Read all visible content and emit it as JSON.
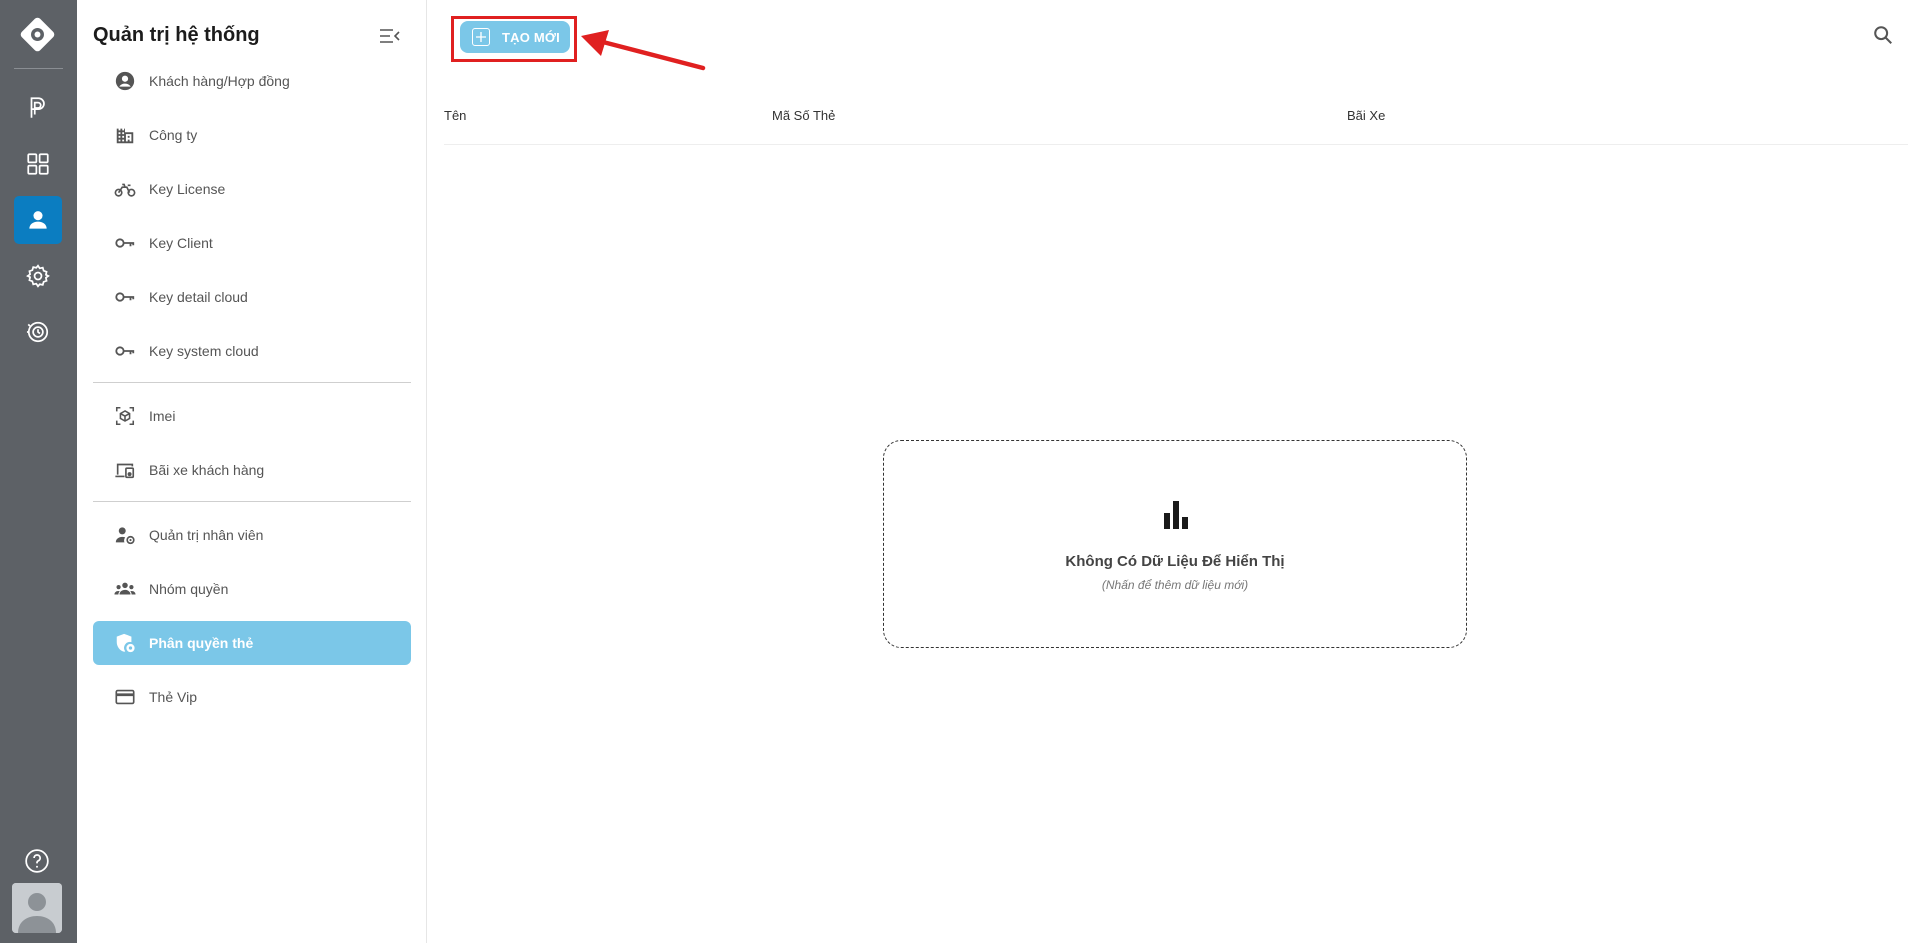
{
  "rail": {
    "items": [
      {
        "icon": "parking-icon"
      },
      {
        "icon": "grid-icon"
      },
      {
        "icon": "user-icon",
        "active": true
      },
      {
        "icon": "gear-icon"
      },
      {
        "icon": "history-icon"
      }
    ],
    "help_icon": "help-icon",
    "avatar": "avatar"
  },
  "sidebar": {
    "title": "Quản trị hệ thống",
    "items": [
      {
        "label": "Khách hàng/Hợp đồng",
        "icon": "account-circle-icon"
      },
      {
        "label": "Công ty",
        "icon": "building-icon"
      },
      {
        "label": "Key License",
        "icon": "motorbike-icon"
      },
      {
        "label": "Key Client",
        "icon": "key-icon"
      },
      {
        "label": "Key detail cloud",
        "icon": "key-icon"
      },
      {
        "label": "Key system cloud",
        "icon": "key-icon"
      },
      {
        "label": "Imei",
        "icon": "scan-box-icon"
      },
      {
        "label": "Bãi xe khách hàng",
        "icon": "devices-icon"
      },
      {
        "label": "Quản trị nhân viên",
        "icon": "user-gear-icon"
      },
      {
        "label": "Nhóm quyền",
        "icon": "group-icon"
      },
      {
        "label": "Phân quyền thẻ",
        "icon": "shield-icon",
        "active": true
      },
      {
        "label": "Thẻ Vip",
        "icon": "credit-card-icon"
      }
    ]
  },
  "toolbar": {
    "create_label": "TẠO MỚI"
  },
  "table": {
    "columns": [
      "Tên",
      "Mã Số Thẻ",
      "Bãi Xe"
    ]
  },
  "empty_state": {
    "title": "Không Có Dữ Liệu Để Hiển Thị",
    "subtitle": "(Nhấn để thêm dữ liệu mới)"
  },
  "colors": {
    "rail_bg": "#5d6166",
    "rail_active": "#0b7dc1",
    "accent": "#7bc7e8",
    "highlight": "#e02020"
  }
}
